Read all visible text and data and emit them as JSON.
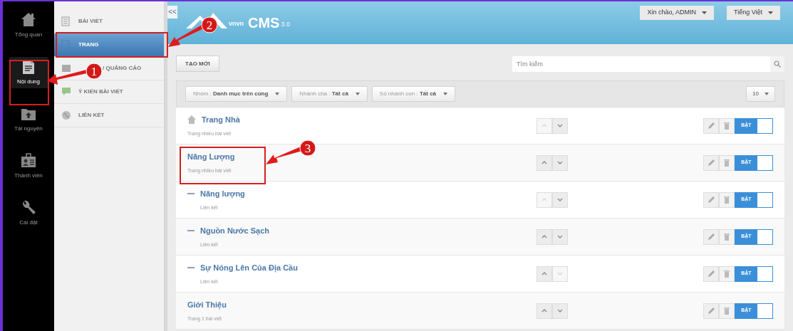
{
  "sidebar": {
    "items": [
      {
        "label": "Tổng quan",
        "kind": "home",
        "selected": false
      },
      {
        "label": "Nội dung",
        "kind": "document",
        "selected": true
      },
      {
        "label": "Tài nguyên",
        "kind": "folder",
        "selected": false
      },
      {
        "label": "Thành viên",
        "kind": "members",
        "selected": false
      },
      {
        "label": "Cài đặt",
        "kind": "wrench",
        "selected": false
      }
    ]
  },
  "submenu": {
    "items": [
      {
        "label": "BÀI VIẾT",
        "kind": "list",
        "selected": false
      },
      {
        "label": "TRANG",
        "kind": "page",
        "selected": true
      },
      {
        "label": "/ QUẢNG CÁO",
        "kind": "image",
        "selected": false
      },
      {
        "label": "Ý KIẾN BÀI VIẾT",
        "kind": "comment",
        "selected": false
      },
      {
        "label": "LIÊN KẾT",
        "kind": "globe",
        "selected": false
      }
    ]
  },
  "collapse_button": "<<",
  "header": {
    "logo": {
      "brand": "vnvn",
      "product": "CMS",
      "version": "3.0"
    },
    "user_menu": "Xin chào, ADMIN",
    "language_menu": "Tiếng Việt"
  },
  "toolbar": {
    "create_button": "TẠO MỚI",
    "search": {
      "placeholder": "Tìm kiếm"
    }
  },
  "filters": [
    {
      "label": "Nhóm : ",
      "value": "Danh mục trên cùng"
    },
    {
      "label": "Nhánh cha : ",
      "value": "Tất cả"
    },
    {
      "label": "Số nhánh con : ",
      "value": "Tất cả"
    }
  ],
  "page_size": "10",
  "rows": [
    {
      "title": "Trang Nhà",
      "subtitle": "Trang nhiều bài viết",
      "kind": "home",
      "up_disabled": true,
      "down_disabled": false,
      "toggle": "BẬT",
      "on": true
    },
    {
      "title": "Năng Lượng",
      "subtitle": "Trang nhiều bài viết",
      "up_disabled": false,
      "down_disabled": false,
      "toggle": "BẬT",
      "on": true,
      "children": [
        {
          "title": "Năng lượng",
          "subtitle": "Liên kết",
          "up_disabled": true,
          "down_disabled": false,
          "toggle": "BẬT",
          "on": true
        },
        {
          "title": "Nguồn Nước Sạch",
          "subtitle": "Liên kết",
          "up_disabled": false,
          "down_disabled": false,
          "toggle": "BẬT",
          "on": true
        },
        {
          "title": "Sự Nóng Lên Của Địa Cầu",
          "subtitle": "Liên kết",
          "up_disabled": false,
          "down_disabled": true,
          "toggle": "BẬT",
          "on": true
        }
      ]
    },
    {
      "title": "Giới Thiệu",
      "subtitle": "Trang 1 bài viết",
      "up_disabled": false,
      "down_disabled": false,
      "toggle": "BẬT",
      "on": true
    }
  ],
  "annotations": [
    {
      "number": "1"
    },
    {
      "number": "2"
    },
    {
      "number": "3"
    }
  ]
}
